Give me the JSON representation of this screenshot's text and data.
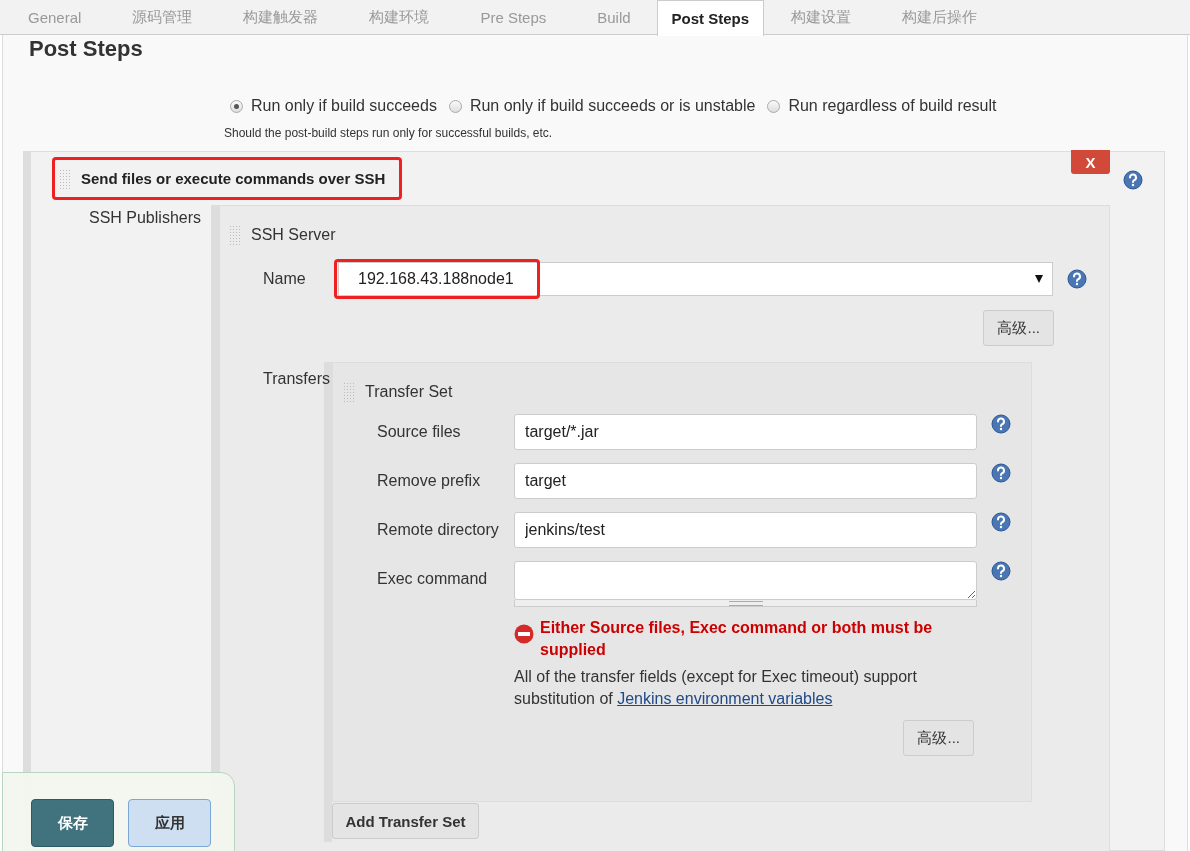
{
  "tabs": [
    {
      "label": "General",
      "selected": false
    },
    {
      "label": "源码管理",
      "selected": false
    },
    {
      "label": "构建触发器",
      "selected": false
    },
    {
      "label": "构建环境",
      "selected": false
    },
    {
      "label": "Pre Steps",
      "selected": false
    },
    {
      "label": "Build",
      "selected": false
    },
    {
      "label": "Post Steps",
      "selected": true
    },
    {
      "label": "构建设置",
      "selected": false
    },
    {
      "label": "构建后操作",
      "selected": false
    }
  ],
  "title": "Post Steps",
  "run_condition": {
    "options": [
      {
        "label": "Run only if build succeeds",
        "selected": true
      },
      {
        "label": "Run only if build succeeds or is unstable",
        "selected": false
      },
      {
        "label": "Run regardless of build result",
        "selected": false
      }
    ],
    "help": "Should the post-build steps run only for successful builds, etc."
  },
  "step": {
    "title": "Send files or execute commands over SSH",
    "highlighted": true,
    "delete_button": "X",
    "publishers_label": "SSH Publishers",
    "server": {
      "title": "SSH Server",
      "name_label": "Name",
      "name_value": "192.168.43.188node1",
      "name_highlighted": true,
      "advanced_button": "高级...",
      "transfers_label": "Transfers",
      "transfer_set": {
        "title": "Transfer Set",
        "fields": [
          {
            "label": "Source files",
            "value": "target/*.jar",
            "kind": "input"
          },
          {
            "label": "Remove prefix",
            "value": "target",
            "kind": "input"
          },
          {
            "label": "Remote directory",
            "value": "jenkins/test",
            "kind": "input"
          },
          {
            "label": "Exec command",
            "kind": "textarea"
          }
        ],
        "error": "Either Source files, Exec command or both must be supplied",
        "note": "All of the transfer fields (except for Exec timeout) support substitution of",
        "note_link": "Jenkins environment variables",
        "advanced_button": "高级..."
      },
      "add_button": "Add Transfer Set"
    }
  },
  "footer_buttons": [
    {
      "label": "保存",
      "kind": "primary"
    },
    {
      "label": "应用",
      "kind": "secondary"
    }
  ]
}
